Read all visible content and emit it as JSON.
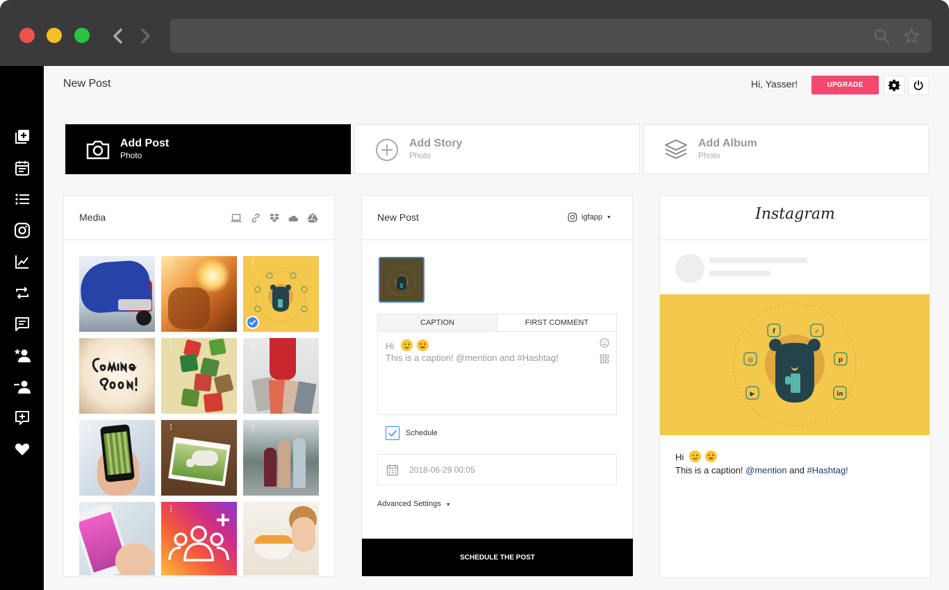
{
  "header": {
    "title": "New Post",
    "greeting": "Hi, Yasser!",
    "upgrade_label": "UPGRADE"
  },
  "post_types": [
    {
      "title": "Add Post",
      "subtitle": "Photo",
      "active": true
    },
    {
      "title": "Add Story",
      "subtitle": "Photo",
      "active": false
    },
    {
      "title": "Add Album",
      "subtitle": "Photo",
      "active": false
    }
  ],
  "media": {
    "title": "Media"
  },
  "compose": {
    "title": "New Post",
    "account": "igfapp",
    "tabs": [
      "CAPTION",
      "FIRST COMMENT"
    ],
    "caption_line1": "Hi",
    "caption_line2": "This is a caption! @mention and #Hashtag!",
    "schedule_label": "Schedule",
    "schedule_date": "2018-06-29 00:05",
    "advanced_label": "Advanced Settings",
    "submit_label": "SCHEDULE THE POST"
  },
  "preview": {
    "logo": "Instagram",
    "caption_line1": "Hi",
    "caption_line2_plain": "This is a caption! ",
    "mention": "@mention",
    "caption_and": " and ",
    "hashtag": "#Hashtag!"
  },
  "colors": {
    "accent": "#f6476f",
    "selected": "#3b82f6",
    "preview_bg": "#f4c74d"
  }
}
